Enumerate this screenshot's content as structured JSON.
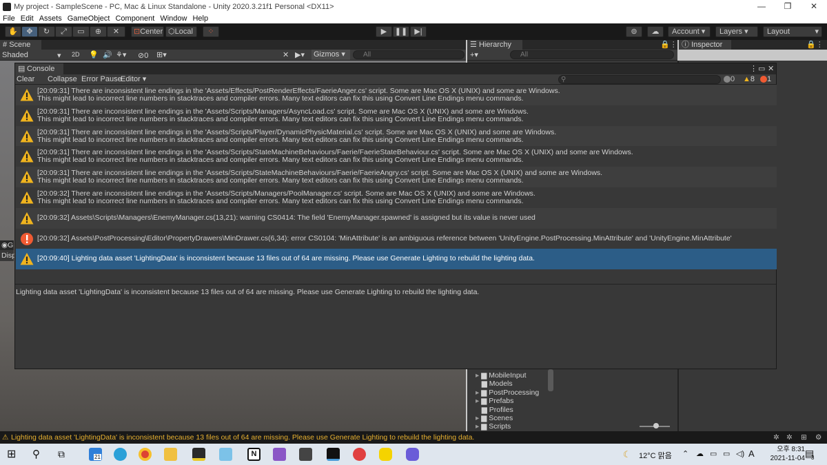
{
  "window": {
    "title": "My project - SampleScene - PC, Mac & Linux Standalone - Unity 2020.3.21f1 Personal <DX11>"
  },
  "menu": [
    "File",
    "Edit",
    "Assets",
    "GameObject",
    "Component",
    "Window",
    "Help"
  ],
  "toolbar": {
    "center_label": "Center",
    "local_label": "Local",
    "account_label": "Account",
    "layers_label": "Layers",
    "layout_label": "Layout"
  },
  "scene": {
    "tab": "Scene",
    "shading": "Shaded",
    "mode_2d": "2D",
    "gizmos": "Gizmos",
    "search_placeholder": "All",
    "hidden_count": "0"
  },
  "hierarchy": {
    "tab": "Hierarchy",
    "search_placeholder": "All"
  },
  "inspector": {
    "tab": "Inspector"
  },
  "console": {
    "tab": "Console",
    "buttons": {
      "clear": "Clear",
      "collapse": "Collapse",
      "error_pause": "Error Pause",
      "editor": "Editor"
    },
    "counts": {
      "logs": "0",
      "warnings": "8",
      "errors": "1"
    },
    "entries": [
      {
        "type": "warning",
        "line1": "[20:09:31] There are inconsistent line endings in the 'Assets/Effects/PostRenderEffects/FaerieAnger.cs' script. Some are Mac OS X (UNIX) and some are Windows.",
        "line2": "This might lead to incorrect line numbers in stacktraces and compiler errors. Many text editors can fix this using Convert Line Endings menu commands."
      },
      {
        "type": "warning",
        "line1": "[20:09:31] There are inconsistent line endings in the 'Assets/Scripts/Managers/AsyncLoad.cs' script. Some are Mac OS X (UNIX) and some are Windows.",
        "line2": "This might lead to incorrect line numbers in stacktraces and compiler errors. Many text editors can fix this using Convert Line Endings menu commands."
      },
      {
        "type": "warning",
        "line1": "[20:09:31] There are inconsistent line endings in the 'Assets/Scripts/Player/DynamicPhysicMaterial.cs' script. Some are Mac OS X (UNIX) and some are Windows.",
        "line2": "This might lead to incorrect line numbers in stacktraces and compiler errors. Many text editors can fix this using Convert Line Endings menu commands."
      },
      {
        "type": "warning",
        "line1": "[20:09:31] There are inconsistent line endings in the 'Assets/Scripts/StateMachineBehaviours/Faerie/FaerieStateBehaviour.cs' script. Some are Mac OS X (UNIX) and some are Windows.",
        "line2": "This might lead to incorrect line numbers in stacktraces and compiler errors. Many text editors can fix this using Convert Line Endings menu commands."
      },
      {
        "type": "warning",
        "line1": "[20:09:31] There are inconsistent line endings in the 'Assets/Scripts/StateMachineBehaviours/Faerie/FaerieAngry.cs' script. Some are Mac OS X (UNIX) and some are Windows.",
        "line2": "This might lead to incorrect line numbers in stacktraces and compiler errors. Many text editors can fix this using Convert Line Endings menu commands."
      },
      {
        "type": "warning",
        "line1": "[20:09:32] There are inconsistent line endings in the 'Assets/Scripts/Managers/PoolManager.cs' script. Some are Mac OS X (UNIX) and some are Windows.",
        "line2": "This might lead to incorrect line numbers in stacktraces and compiler errors. Many text editors can fix this using Convert Line Endings menu commands."
      },
      {
        "type": "warning",
        "line1": "[20:09:32] Assets\\Scripts\\Managers\\EnemyManager.cs(13,21): warning CS0414: The field 'EnemyManager.spawned' is assigned but its value is never used",
        "line2": ""
      },
      {
        "type": "error",
        "line1": "[20:09:32] Assets\\PostProcessing\\Editor\\PropertyDrawers\\MinDrawer.cs(6,34): error CS0104: 'MinAttribute' is an ambiguous reference between 'UnityEngine.PostProcessing.MinAttribute' and 'UnityEngine.MinAttribute'",
        "line2": ""
      },
      {
        "type": "warning",
        "line1": "[20:09:40] Lighting data asset 'LightingData' is inconsistent because 13 files out of 64 are missing.  Please use Generate Lighting to rebuild the lighting data.",
        "line2": "",
        "selected": true
      }
    ],
    "detail": "Lighting data asset 'LightingData' is inconsistent because 13 files out of 64 are missing.  Please use Generate Lighting to rebuild the lighting data."
  },
  "project_tree": [
    "MobileInput",
    "Models",
    "PostProcessing",
    "Prefabs",
    "Profiles",
    "Scenes",
    "Scripts"
  ],
  "side_fragments": {
    "game_tab": "G",
    "display": "Disp"
  },
  "status": {
    "message": "Lighting data asset 'LightingData' is inconsistent because 13 files out of 64 are missing.  Please use Generate Lighting to rebuild the lighting data."
  },
  "taskbar": {
    "weather": "12°C  맑음",
    "ime": "A",
    "time": "오후 8:31",
    "date": "2021-11-04",
    "notification_count": "3",
    "calendar_badge": "21"
  },
  "colors": {
    "warning": "#f0b41e",
    "error": "#f05a32",
    "selection": "#2c5d87",
    "status_text": "#e8b130"
  }
}
